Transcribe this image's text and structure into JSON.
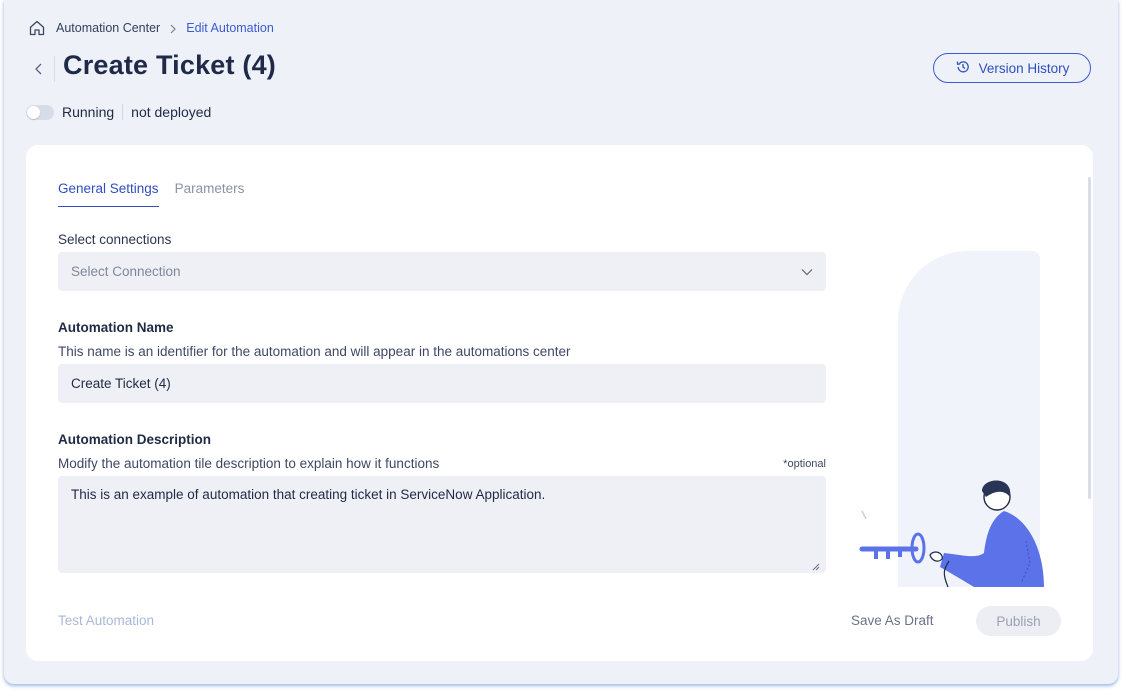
{
  "breadcrumb": {
    "home_icon": "home-icon",
    "parent": "Automation Center",
    "current": "Edit Automation"
  },
  "header": {
    "title": "Create Ticket (4)",
    "version_history_label": "Version History",
    "version_history_icon": "history-icon"
  },
  "status": {
    "running_label": "Running",
    "deploy_state": "not deployed",
    "running": false
  },
  "tabs": [
    {
      "label": "General Settings",
      "active": true
    },
    {
      "label": "Parameters",
      "active": false
    }
  ],
  "form": {
    "connections_label": "Select connections",
    "connections_placeholder": "Select Connection",
    "name_label": "Automation Name",
    "name_help": "This name is an identifier for the automation and will appear in the automations center",
    "name_value": "Create Ticket (4)",
    "description_label": "Automation Description",
    "description_help": "Modify the automation tile description to explain how it functions",
    "description_optional": "*optional",
    "description_value": "This is an example of automation that creating ticket in ServiceNow Application."
  },
  "footer": {
    "test_label": "Test Automation",
    "draft_label": "Save As Draft",
    "publish_label": "Publish"
  },
  "colors": {
    "accent": "#2f4fbf",
    "page_bg": "#eef1f8",
    "illustration_blue": "#5b72e8"
  }
}
